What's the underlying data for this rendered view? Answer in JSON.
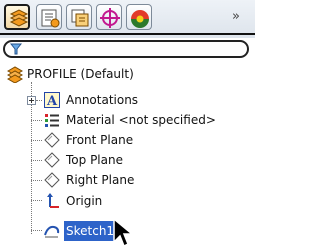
{
  "tabs": [
    {
      "name": "feature-manager-tab",
      "icon": "feature-tree-icon",
      "active": true
    },
    {
      "name": "property-manager-tab",
      "icon": "property-manager-icon",
      "active": false
    },
    {
      "name": "configuration-manager-tab",
      "icon": "configuration-manager-icon",
      "active": false
    },
    {
      "name": "dimxpert-manager-tab",
      "icon": "dimxpert-icon",
      "active": false
    },
    {
      "name": "display-manager-tab",
      "icon": "display-manager-icon",
      "active": false
    }
  ],
  "overflow_label": "»",
  "filter": {
    "icon": "filter-icon",
    "value": ""
  },
  "tree": {
    "root": {
      "label": "PROFILE  (Default)",
      "icon": "part-icon"
    },
    "items": [
      {
        "label": "Annotations",
        "icon": "annotations-icon",
        "expandable": true
      },
      {
        "label": "Material <not specified>",
        "icon": "material-icon"
      },
      {
        "label": "Front Plane",
        "icon": "plane-icon"
      },
      {
        "label": "Top Plane",
        "icon": "plane-icon"
      },
      {
        "label": "Right Plane",
        "icon": "plane-icon"
      },
      {
        "label": "Origin",
        "icon": "origin-icon"
      },
      {
        "label": "Sketch1",
        "icon": "sketch-icon",
        "selected": true
      }
    ]
  },
  "colors": {
    "selection": "#2d63c9",
    "accent_orange": "#f39a1e",
    "annotation_blue": "#2345a8"
  }
}
